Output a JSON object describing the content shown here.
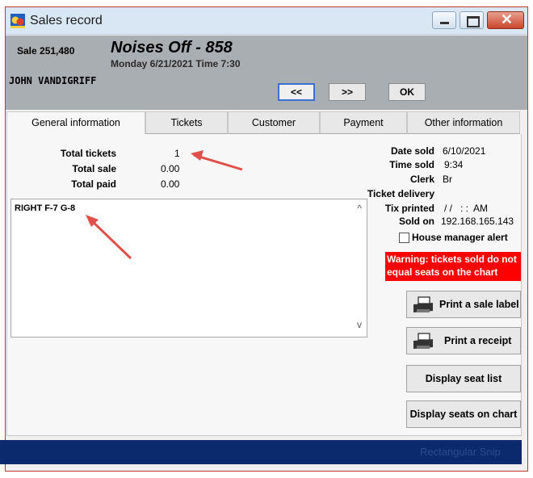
{
  "window": {
    "title": "Sales record",
    "icon": "theater-masks-icon",
    "close_glyph": "✕"
  },
  "header": {
    "sale_number": "Sale 251,480",
    "show_title": "Noises Off - 858",
    "show_date": "Monday 6/21/2021  Time 7:30",
    "customer_name": "JOHN VANDIGRIFF",
    "prev_label": "<<",
    "next_label": ">>",
    "ok_label": "OK"
  },
  "tabs": [
    {
      "label": "General information",
      "active": true
    },
    {
      "label": "Tickets",
      "active": false
    },
    {
      "label": "Customer",
      "active": false
    },
    {
      "label": "Payment",
      "active": false
    },
    {
      "label": "Other information",
      "active": false
    }
  ],
  "totals": {
    "total_tickets_label": "Total tickets",
    "total_tickets_value": "1",
    "total_sale_label": "Total sale",
    "total_sale_value": "0.00",
    "total_paid_label": "Total paid",
    "total_paid_value": "0.00"
  },
  "notes": {
    "text": "RIGHT F-7 G-8"
  },
  "info": {
    "date_sold_label": "Date sold",
    "date_sold_value": "6/10/2021",
    "time_sold_label": "Time sold",
    "time_sold_value": "9:34",
    "clerk_label": "Clerk",
    "clerk_value": "Br",
    "ticket_delivery_label": "Ticket delivery",
    "tix_printed_label": "Tix printed",
    "tix_printed_value": "/ /   : :  AM",
    "sold_on_label": "Sold on",
    "sold_on_value": "192.168.165.143",
    "house_manager_alert_label": "House manager alert",
    "house_manager_alert_checked": false
  },
  "warning": {
    "text": "Warning: tickets sold do not equal seats on the chart",
    "color": "#ff0000"
  },
  "actions": {
    "print_sale_label": "Print a sale label",
    "print_receipt": "Print a receipt",
    "display_seat_list": "Display seat list",
    "display_seats_on_chart": "Display seats on chart"
  },
  "bottom": {
    "ghost_text": "Rectangular Snip"
  }
}
